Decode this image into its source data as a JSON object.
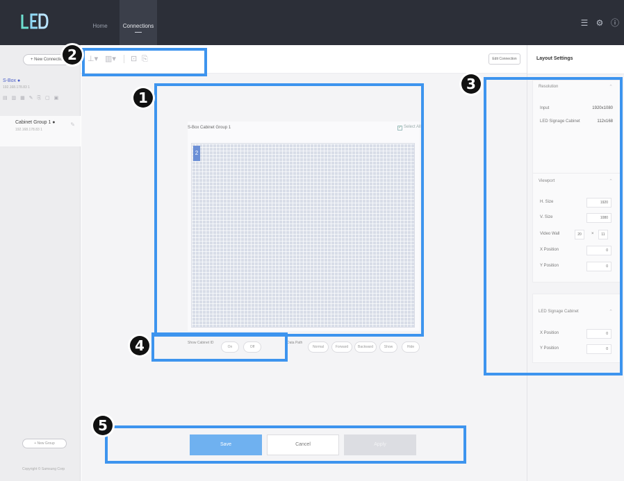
{
  "app": {
    "logo_text": "LED"
  },
  "nav": {
    "tabs": [
      {
        "label": "Home"
      },
      {
        "label": "Connections"
      }
    ]
  },
  "top_icons": [
    "list-icon",
    "gear-icon",
    "help-icon"
  ],
  "sidebar": {
    "new_connection_label": "+ New Connection",
    "items": [
      {
        "name": "S-Box ●",
        "sub": "192.168.178.83 1"
      },
      {
        "name": "Cabinet Group 1 ●",
        "sub": "192.168.178.83 1"
      }
    ],
    "new_group_label": "+ New Group",
    "copyright": "Copyright © Samsung Corp"
  },
  "toolbar": {
    "edit_connection_label": "Edit Connection"
  },
  "canvas": {
    "cabinet_title": "S-Box Cabinet Group 1",
    "select_all_label": "Select All",
    "grid_label": "2",
    "show_cabinet_id_label": "Show Cabinet ID",
    "on_label": "On",
    "off_label": "Off",
    "data_path_label": "Data Path",
    "path_options": [
      "Normal",
      "Forward",
      "Backward",
      "Show",
      "Hide"
    ]
  },
  "actions": {
    "save": "Save",
    "cancel": "Cancel",
    "apply": "Apply"
  },
  "layout_settings": {
    "title": "Layout Settings",
    "resolution": {
      "section": "Resolution",
      "input_label": "Input",
      "input_value": "1920x1080",
      "cabinet_label": "LED Signage Cabinet",
      "cabinet_value": "112x168"
    },
    "viewport": {
      "section": "Viewport",
      "h_size_label": "H. Size",
      "h_size_value": "1920",
      "v_size_label": "V. Size",
      "v_size_value": "1080",
      "video_wall_label": "Video Wall",
      "video_wall_cols": "20",
      "video_wall_rows": "11",
      "x_label": "X Position",
      "x_value": "0",
      "y_label": "Y Position",
      "y_value": "0"
    },
    "cabinet": {
      "section": "LED Signage Cabinet",
      "x_label": "X Position",
      "x_value": "0",
      "y_label": "Y Position",
      "y_value": "0"
    }
  },
  "callouts": [
    "1",
    "2",
    "3",
    "4",
    "5"
  ],
  "colors": {
    "callout": "#3d94ee",
    "topbar": "#2c2f38",
    "save": "#6fb1f0",
    "grid": "#d8dde8"
  }
}
